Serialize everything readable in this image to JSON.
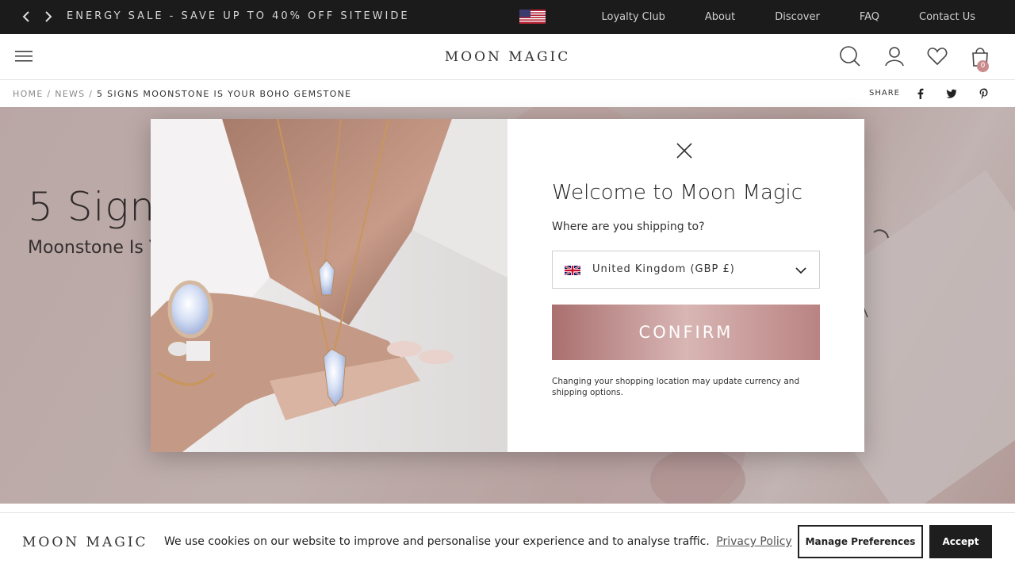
{
  "topbar": {
    "promo": "ENERGY SALE - SAVE UP TO 40% OFF SITEWIDE",
    "links": [
      "Loyalty Club",
      "About",
      "Discover",
      "FAQ",
      "Contact Us"
    ]
  },
  "header": {
    "logo": "MOON MAGIC",
    "cart_count": "0"
  },
  "breadcrumb": {
    "home": "HOME",
    "news": "NEWS",
    "current": "5 SIGNS MOONSTONE IS YOUR BOHO GEMSTONE",
    "separator": "/",
    "share_label": "SHARE"
  },
  "hero": {
    "title": "5 Signs",
    "subtitle": "Moonstone Is Y"
  },
  "modal": {
    "title": "Welcome to Moon Magic",
    "question": "Where are you shipping to?",
    "selected_country": "United Kingdom (GBP £)",
    "confirm_label": "CONFIRM",
    "note": "Changing your shopping location may update currency and shipping options."
  },
  "cookie": {
    "logo": "MOON MAGIC",
    "text": "We use cookies on our website to improve and personalise your experience and to analyse traffic.",
    "privacy_link": "Privacy Policy",
    "prefs_label": "Manage Preferences",
    "accept_label": "Accept"
  },
  "colors": {
    "topbar_bg": "#1b1b1b",
    "accent_rose": "#c98b8b",
    "confirm_gradient": "#a9706f"
  }
}
